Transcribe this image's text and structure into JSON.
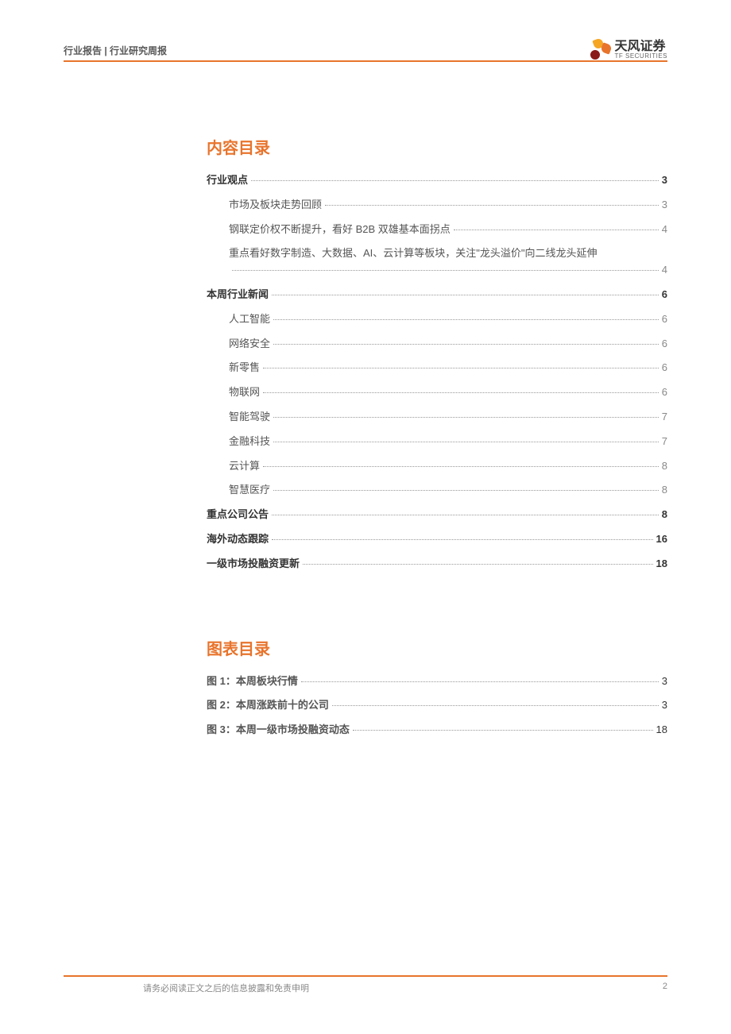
{
  "header": {
    "category": "行业报告 | 行业研究周报",
    "company_cn": "天风证券",
    "company_en": "TF SECURITIES"
  },
  "toc": {
    "title": "内容目录",
    "items": [
      {
        "label": "行业观点",
        "page": "3",
        "level": 0
      },
      {
        "label": "市场及板块走势回顾",
        "page": "3",
        "level": 1
      },
      {
        "label": "钢联定价权不断提升，看好 B2B 双雄基本面拐点",
        "page": "4",
        "level": 1
      },
      {
        "label": "重点看好数字制造、大数据、AI、云计算等板块，关注\"龙头溢价\"向二线龙头延伸",
        "page": "4",
        "level": 1,
        "wrap": true
      },
      {
        "label": "本周行业新闻",
        "page": "6",
        "level": 0
      },
      {
        "label": "人工智能",
        "page": "6",
        "level": 1
      },
      {
        "label": "网络安全",
        "page": "6",
        "level": 1
      },
      {
        "label": "新零售",
        "page": "6",
        "level": 1
      },
      {
        "label": "物联网",
        "page": "6",
        "level": 1
      },
      {
        "label": "智能驾驶",
        "page": "7",
        "level": 1
      },
      {
        "label": "金融科技",
        "page": "7",
        "level": 1
      },
      {
        "label": "云计算",
        "page": "8",
        "level": 1
      },
      {
        "label": "智慧医疗",
        "page": "8",
        "level": 1
      },
      {
        "label": "重点公司公告",
        "page": "8",
        "level": 0
      },
      {
        "label": "海外动态跟踪",
        "page": "16",
        "level": 0
      },
      {
        "label": "一级市场投融资更新",
        "page": "18",
        "level": 0
      }
    ]
  },
  "figures": {
    "title": "图表目录",
    "items": [
      {
        "label": "图 1：本周板块行情",
        "page": "3"
      },
      {
        "label": "图 2：本周涨跌前十的公司",
        "page": "3"
      },
      {
        "label": "图 3：本周一级市场投融资动态",
        "page": "18"
      }
    ]
  },
  "footer": {
    "disclaimer": "请务必阅读正文之后的信息披露和免责申明",
    "page_number": "2"
  }
}
